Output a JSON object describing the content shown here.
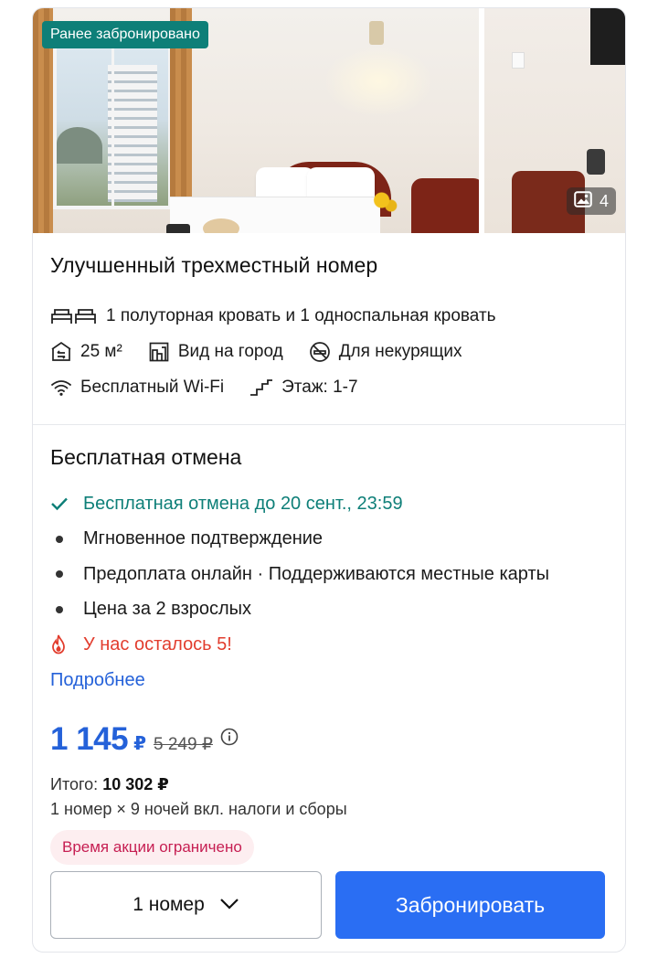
{
  "photos": {
    "badge": "Ранее забронировано",
    "count": "4",
    "count_icon": "image-gallery-icon"
  },
  "room": {
    "title": "Улучшенный трехместный номер",
    "bed": "1 полуторная кровать и 1 односпальная кровать",
    "area": "25 м²",
    "view": "Вид на город",
    "smoking": "Для некурящих",
    "wifi": "Бесплатный Wi-Fi",
    "floor": "Этаж: 1-7"
  },
  "rate": {
    "title": "Бесплатная отмена",
    "perks": [
      {
        "text": "Бесплатная отмена до 20 сент., 23:59",
        "kind": "check",
        "color": "#0e7f78"
      },
      {
        "text": "Мгновенное подтверждение",
        "kind": "bullet"
      },
      {
        "text": "Предоплата онлайн · Поддерживаются местные карты",
        "kind": "bullet"
      },
      {
        "text": "Цена за 2 взрослых",
        "kind": "bullet"
      },
      {
        "text": "У нас осталось 5!",
        "kind": "fire",
        "color": "#e23d2e"
      }
    ],
    "details_link": "Подробнее"
  },
  "pricing": {
    "price": "1 145",
    "currency": "₽",
    "old_price": "5 249 ₽",
    "total_label": "Итого:",
    "total_value": "10 302 ₽",
    "breakdown": "1 номер × 9 ночей вкл. налоги и сборы",
    "promo": "Время акции ограничено"
  },
  "actions": {
    "rooms_select": "1 номер",
    "book_button": "Забронировать"
  },
  "colors": {
    "accent_blue": "#2461d9",
    "button_blue": "#2a6ef3",
    "teal": "#0e7f78",
    "alert_red": "#e23d2e",
    "promo_pink": "#c61e52"
  }
}
